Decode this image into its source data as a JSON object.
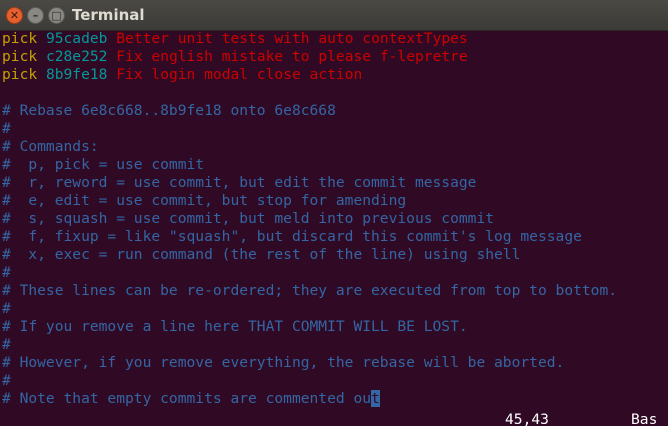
{
  "window": {
    "title": "Terminal"
  },
  "picks": [
    {
      "cmd": "pick",
      "hash": "95cadeb",
      "message": "Better unit tests with auto contextTypes"
    },
    {
      "cmd": "pick",
      "hash": "c28e252",
      "message": "Fix english mistake to please f-lepretre"
    },
    {
      "cmd": "pick",
      "hash": "8b9fe18",
      "message": "Fix login modal close action"
    }
  ],
  "comments": [
    "# Rebase 6e8c668..8b9fe18 onto 6e8c668",
    "#",
    "# Commands:",
    "#  p, pick = use commit",
    "#  r, reword = use commit, but edit the commit message",
    "#  e, edit = use commit, but stop for amending",
    "#  s, squash = use commit, but meld into previous commit",
    "#  f, fixup = like \"squash\", but discard this commit's log message",
    "#  x, exec = run command (the rest of the line) using shell",
    "#",
    "# These lines can be re-ordered; they are executed from top to bottom.",
    "#",
    "# If you remove a line here THAT COMMIT WILL BE LOST.",
    "#",
    "# However, if you remove everything, the rebase will be aborted.",
    "#"
  ],
  "last_line": {
    "before_cursor": "# Note that empty commits are commented ou",
    "cursor_char": "t"
  },
  "status": {
    "position": "45,43",
    "scroll": "Bas"
  },
  "colors": {
    "background": "#300a24",
    "keyword": "#c4a000",
    "hash": "#06989a",
    "message": "#cc0000",
    "comment": "#3465a4"
  }
}
